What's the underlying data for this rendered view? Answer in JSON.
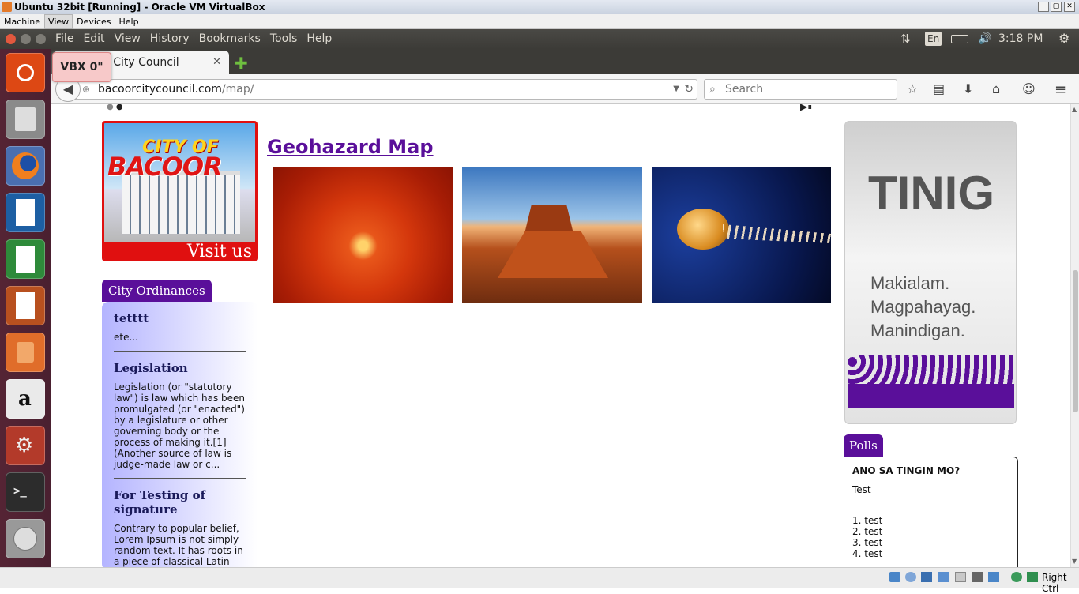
{
  "vbox": {
    "title": "Ubuntu 32bit [Running] - Oracle VM VirtualBox",
    "menu": [
      "Machine",
      "View",
      "Devices",
      "Help"
    ],
    "status_right": "Right Ctrl"
  },
  "ff_menu": [
    "File",
    "Edit",
    "View",
    "History",
    "Bookmarks",
    "Tools",
    "Help"
  ],
  "indicators": {
    "lang": "En",
    "time": "3:18 PM"
  },
  "tab": {
    "title": "Bacoor City Council"
  },
  "badge": "VBX 0\"",
  "url": {
    "domain": "bacoorcitycouncil.com",
    "path": "/map/"
  },
  "search": {
    "placeholder": "Search"
  },
  "page": {
    "banner": {
      "line1": "CITY OF",
      "line2": "BACOOR",
      "cta": "Visit us"
    },
    "heading": "Geohazard Map",
    "ordinances": {
      "tab": "City Ordinances",
      "items": [
        {
          "title": "tetttt",
          "text": "ete..."
        },
        {
          "title": "Legislation",
          "text": "Legislation (or \"statutory law\") is law which has been promulgated (or \"enacted\") by a legislature or other governing body or the process of making it.[1] (Another source of law is judge-made law or c..."
        },
        {
          "title": "For Testing of signature",
          "text": "Contrary to popular belief, Lorem Ipsum is not simply random text. It has roots in a piece of classical Latin"
        }
      ]
    },
    "tinig": {
      "title": "TINIG",
      "lines": [
        "Makialam.",
        "Magpahayag.",
        "Manindigan."
      ]
    },
    "polls": {
      "tab": "Polls",
      "question": "ANO SA TINGIN MO?",
      "sub": "Test",
      "options": [
        "1. test",
        "2. test",
        "3. test",
        "4. test"
      ]
    }
  },
  "colors": {
    "purple": "#5a0f9a",
    "ubuntu_panel": "#3c3b37",
    "launcher": "#552434"
  }
}
